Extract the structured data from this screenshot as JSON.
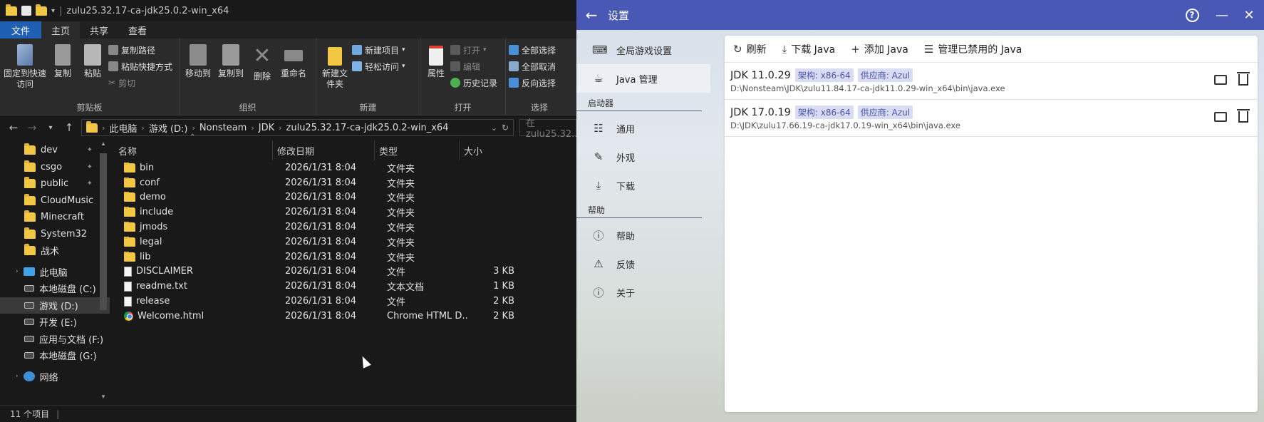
{
  "explorer": {
    "title": "zulu25.32.17-ca-jdk25.0.2-win_x64",
    "tabs": [
      "文件",
      "主页",
      "共享",
      "查看"
    ],
    "ribbon": {
      "clipboard": {
        "group_label": "剪贴板",
        "pin_label": "固定到快速访问",
        "copy_label": "复制",
        "paste_label": "粘贴",
        "copy_path": "复制路径",
        "paste_shortcut": "粘贴快捷方式",
        "cut": "剪切"
      },
      "organize": {
        "group_label": "组织",
        "move_to": "移动到",
        "copy_to": "复制到",
        "delete": "删除",
        "rename": "重命名"
      },
      "new": {
        "group_label": "新建",
        "new_folder": "新建文件夹",
        "new_item": "新建项目",
        "easy_access": "轻松访问"
      },
      "open": {
        "group_label": "打开",
        "properties": "属性",
        "open": "打开",
        "edit": "编辑",
        "history": "历史记录"
      },
      "select": {
        "group_label": "选择",
        "select_all": "全部选择",
        "select_none": "全部取消",
        "invert": "反向选择"
      }
    },
    "address": {
      "segments": [
        "此电脑",
        "游戏 (D:)",
        "Nonsteam",
        "JDK",
        "zulu25.32.17-ca-jdk25.0.2-win_x64"
      ],
      "search_placeholder": "在 zulu25.32..."
    },
    "nav": {
      "quick": [
        "dev",
        "csgo",
        "public",
        "CloudMusic",
        "Minecraft",
        "System32",
        "战术"
      ],
      "this_pc": "此电脑",
      "drives": [
        "本地磁盘 (C:)",
        "游戏 (D:)",
        "开发 (E:)",
        "应用与文档 (F:)",
        "本地磁盘 (G:)"
      ],
      "network": "网络"
    },
    "columns": {
      "name": "名称",
      "date": "修改日期",
      "type": "类型",
      "size": "大小"
    },
    "files": [
      {
        "name": "bin",
        "date": "2026/1/31 8:04",
        "type": "文件夹",
        "size": "",
        "kind": "folder"
      },
      {
        "name": "conf",
        "date": "2026/1/31 8:04",
        "type": "文件夹",
        "size": "",
        "kind": "folder"
      },
      {
        "name": "demo",
        "date": "2026/1/31 8:04",
        "type": "文件夹",
        "size": "",
        "kind": "folder"
      },
      {
        "name": "include",
        "date": "2026/1/31 8:04",
        "type": "文件夹",
        "size": "",
        "kind": "folder"
      },
      {
        "name": "jmods",
        "date": "2026/1/31 8:04",
        "type": "文件夹",
        "size": "",
        "kind": "folder"
      },
      {
        "name": "legal",
        "date": "2026/1/31 8:04",
        "type": "文件夹",
        "size": "",
        "kind": "folder"
      },
      {
        "name": "lib",
        "date": "2026/1/31 8:04",
        "type": "文件夹",
        "size": "",
        "kind": "folder"
      },
      {
        "name": "DISCLAIMER",
        "date": "2026/1/31 8:04",
        "type": "文件",
        "size": "3 KB",
        "kind": "file"
      },
      {
        "name": "readme.txt",
        "date": "2026/1/31 8:04",
        "type": "文本文档",
        "size": "1 KB",
        "kind": "file"
      },
      {
        "name": "release",
        "date": "2026/1/31 8:04",
        "type": "文件",
        "size": "2 KB",
        "kind": "file"
      },
      {
        "name": "Welcome.html",
        "date": "2026/1/31 8:04",
        "type": "Chrome HTML D...",
        "size": "2 KB",
        "kind": "chrome"
      }
    ],
    "status": "11 个项目"
  },
  "settings": {
    "title": "设置",
    "nav": {
      "global": "全局游戏设置",
      "java": "Java 管理",
      "launcher_header": "启动器",
      "general": "通用",
      "appearance": "外观",
      "download": "下载",
      "help_header": "帮助",
      "help": "帮助",
      "feedback": "反馈",
      "about": "关于"
    },
    "toolbar": {
      "refresh": "刷新",
      "download": "下载 Java",
      "add": "添加 Java",
      "manage_disabled": "管理已禁用的 Java"
    },
    "java_list": [
      {
        "version": "JDK 11.0.29",
        "arch": "架构: x86-64",
        "vendor": "供应商: Azul",
        "path": "D:\\Nonsteam\\JDK\\zulu11.84.17-ca-jdk11.0.29-win_x64\\bin\\java.exe"
      },
      {
        "version": "JDK 17.0.19",
        "arch": "架构: x86-64",
        "vendor": "供应商: Azul",
        "path": "D:\\JDK\\zulu17.66.19-ca-jdk17.0.19-win_x64\\bin\\java.exe"
      }
    ]
  },
  "colors": {
    "titlebar_accent": "#4957b5",
    "file_tab": "#1f5fb4",
    "folder": "#f2c744",
    "tag_bg": "#d9dcf2",
    "tag_text": "#4a55a8"
  }
}
